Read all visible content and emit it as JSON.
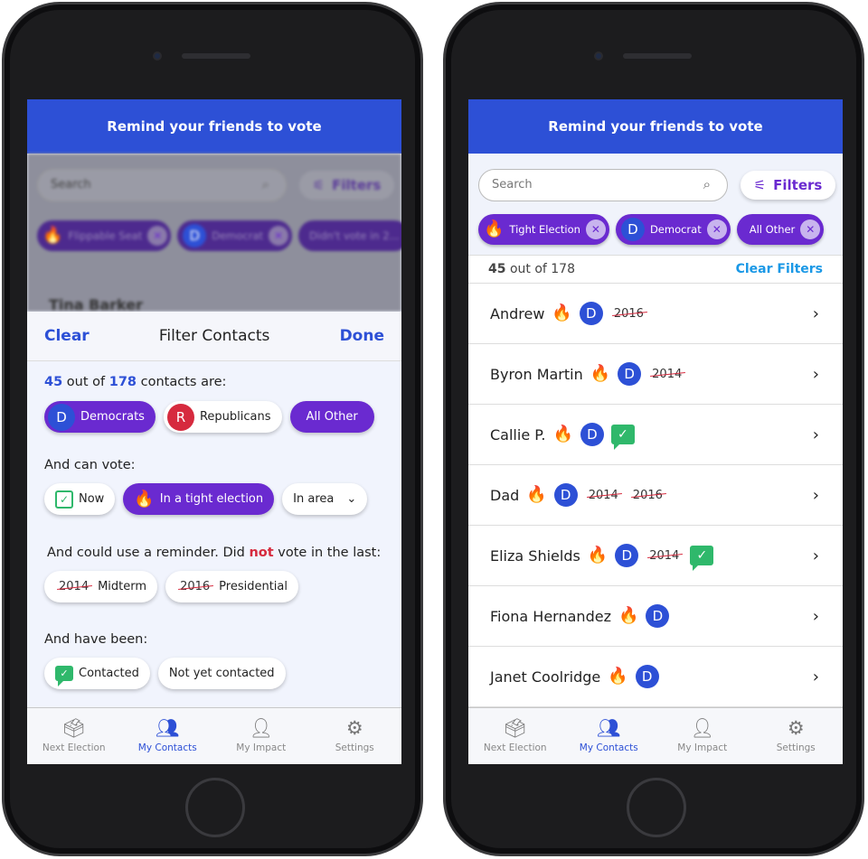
{
  "header_title": "Remind your friends to vote",
  "search_placeholder": "Search",
  "filters_label": "Filters",
  "background": {
    "chips": [
      "Flippable Seat",
      "Democrat",
      "Didn't vote in 2..."
    ],
    "first_contact": "Tina Barker"
  },
  "filter_sheet": {
    "clear": "Clear",
    "title": "Filter Contacts",
    "done": "Done",
    "count": "45",
    "out_of": "out of",
    "total": "178",
    "contacts_are": "contacts are:",
    "party_options": [
      {
        "badge": "D",
        "label": "Democrats",
        "selected": true
      },
      {
        "badge": "R",
        "label": "Republicans",
        "selected": false
      },
      {
        "label": "All Other",
        "selected": true
      }
    ],
    "can_vote_label": "And can vote:",
    "vote_options": [
      {
        "label": "Now",
        "selected": false
      },
      {
        "label": "In a tight election",
        "selected": true
      },
      {
        "label": "In area",
        "selected": false
      }
    ],
    "reminder_prefix": "And could use a reminder. Did",
    "reminder_not": "not",
    "reminder_suffix": "vote in the last:",
    "missed_options": [
      {
        "year": "2014",
        "label": "Midterm"
      },
      {
        "year": "2016",
        "label": "Presidential"
      }
    ],
    "been_label": "And have been:",
    "contact_options": [
      "Contacted",
      "Not yet contacted"
    ]
  },
  "active_filters": [
    {
      "label": "Tight Election",
      "icon": "fire"
    },
    {
      "label": "Democrat",
      "badge": "D"
    },
    {
      "label": "All Other"
    }
  ],
  "count_row": {
    "count": "45",
    "rest": "out of 178",
    "clear": "Clear Filters"
  },
  "contacts": [
    {
      "name": "Andrew",
      "badge": "D",
      "missed": [
        "2016"
      ],
      "contacted": false
    },
    {
      "name": "Byron Martin",
      "badge": "D",
      "missed": [
        "2014"
      ],
      "contacted": false
    },
    {
      "name": "Callie P.",
      "badge": "D",
      "missed": [],
      "contacted": true
    },
    {
      "name": "Dad",
      "badge": "D",
      "missed": [
        "2014",
        "2016"
      ],
      "contacted": false
    },
    {
      "name": "Eliza Shields",
      "badge": "D",
      "missed": [
        "2014"
      ],
      "contacted": true
    },
    {
      "name": "Fiona Hernandez",
      "badge": "D",
      "missed": [],
      "contacted": false
    },
    {
      "name": "Janet Coolridge",
      "badge": "D",
      "missed": [],
      "contacted": false
    }
  ],
  "tabs": [
    {
      "label": "Next Election",
      "icon": "ballot-icon"
    },
    {
      "label": "My Contacts",
      "icon": "contacts-icon",
      "active": true
    },
    {
      "label": "My Impact",
      "icon": "person-icon"
    },
    {
      "label": "Settings",
      "icon": "gear-icon"
    }
  ],
  "colors": {
    "brand_blue": "#2d50d6",
    "purple": "#6a2ad0",
    "red": "#d62a3e",
    "green": "#2fb86b",
    "link": "#1a98e6"
  }
}
